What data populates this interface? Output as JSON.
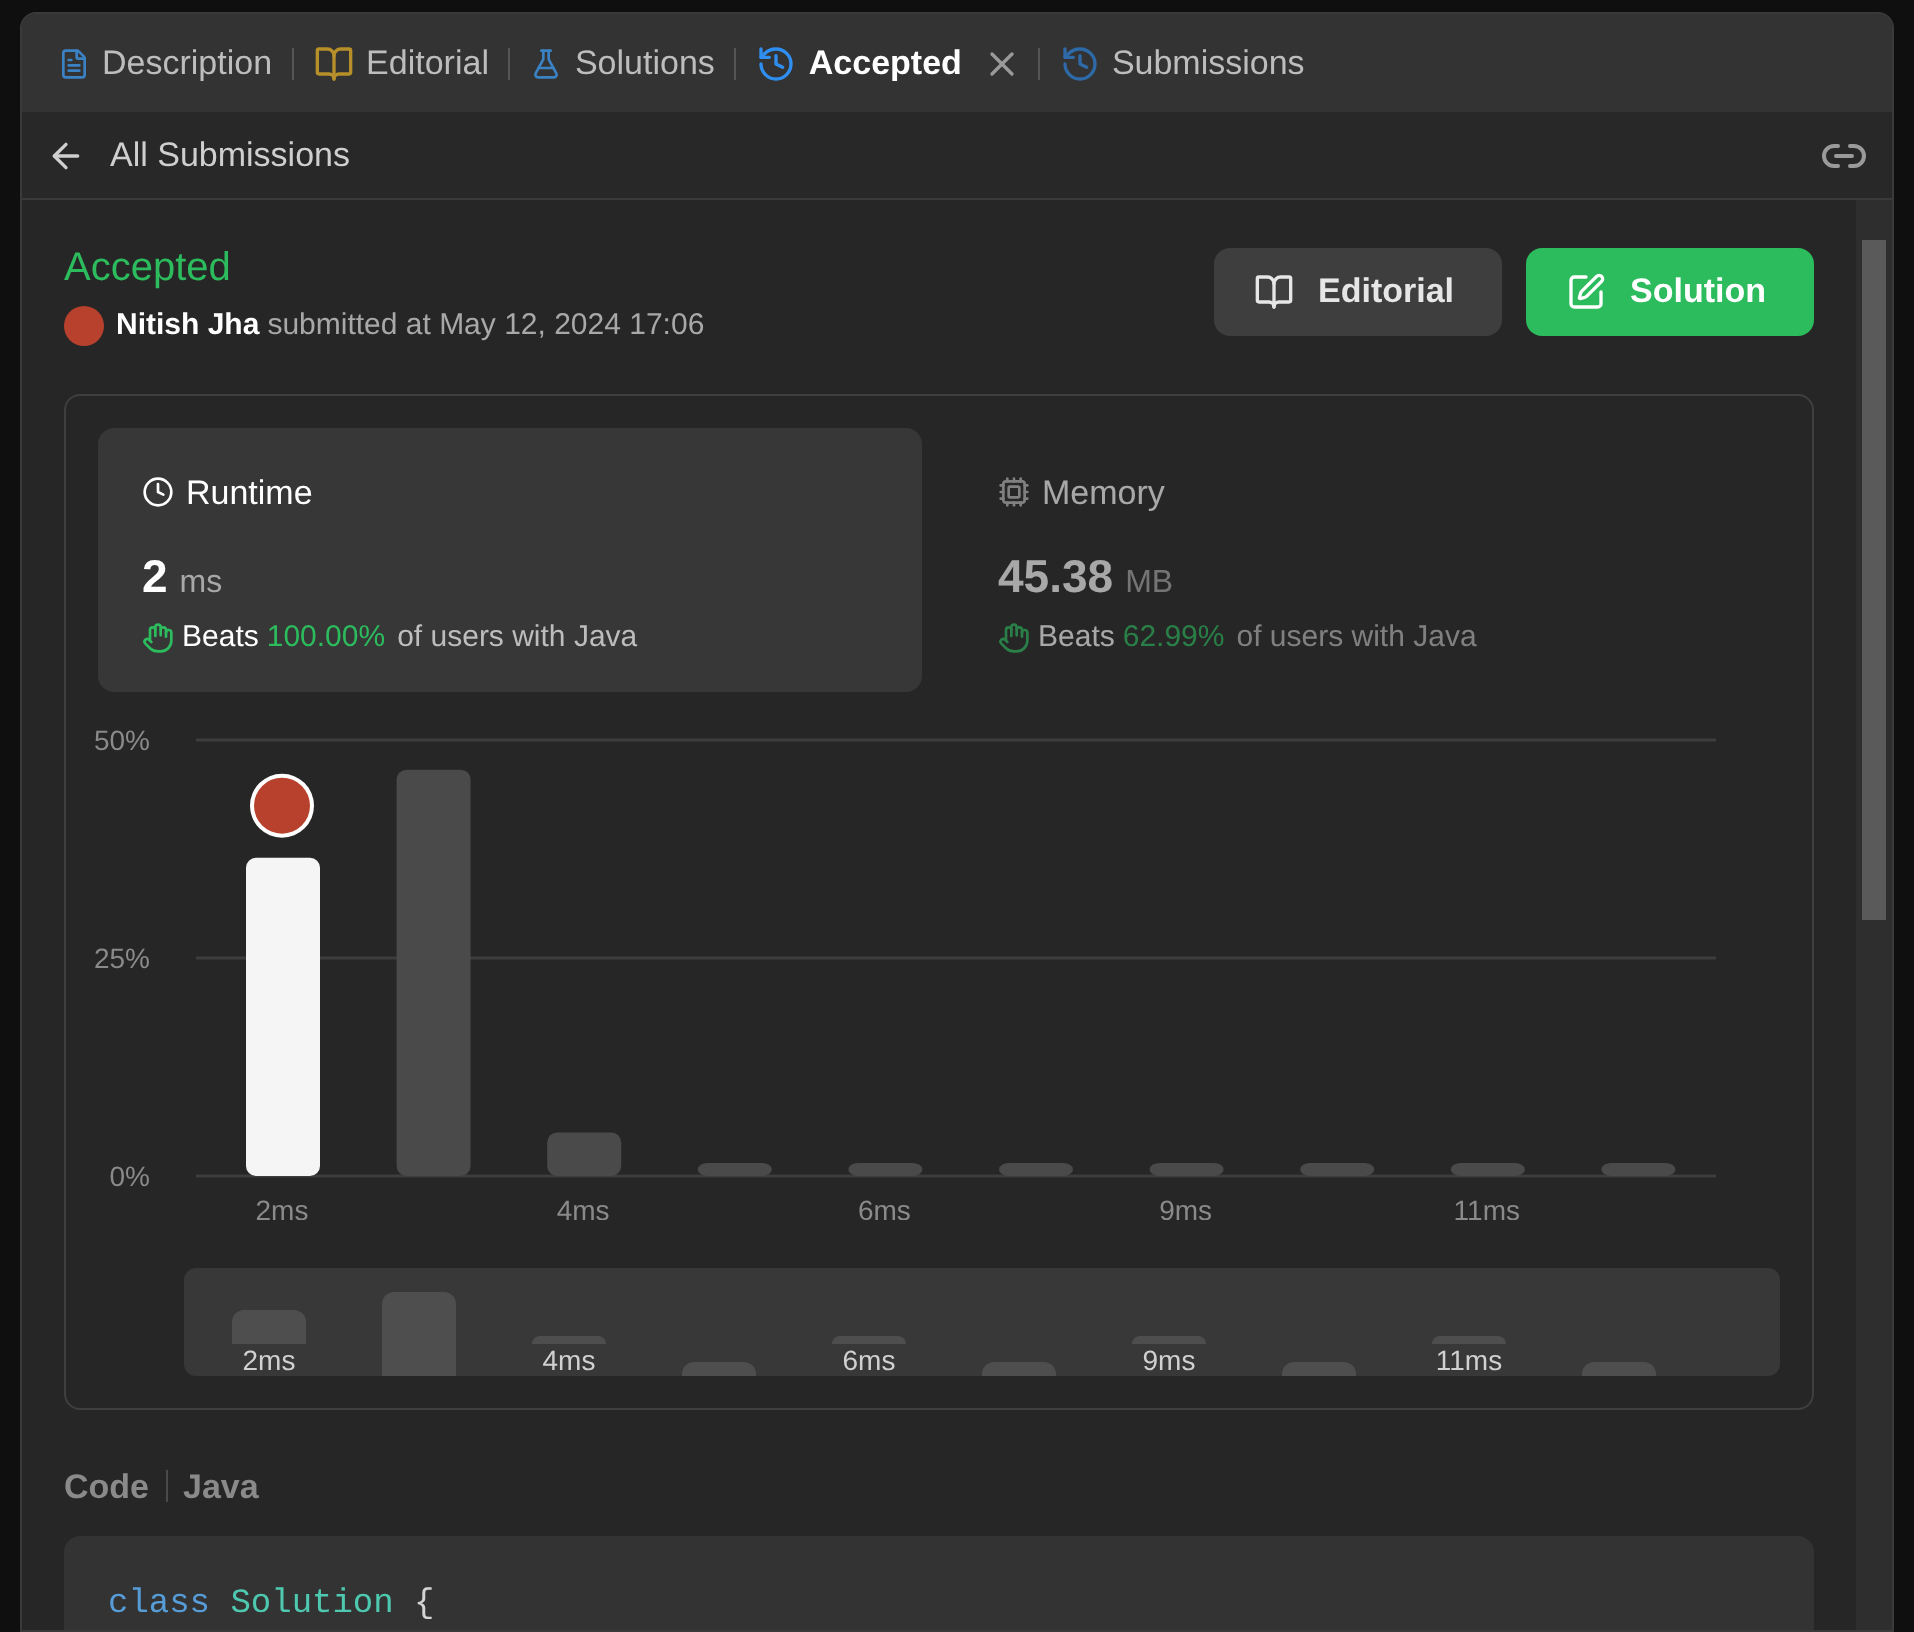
{
  "tabs": [
    {
      "label": "Description",
      "selected": false,
      "closable": false
    },
    {
      "label": "Editorial",
      "selected": false,
      "closable": false
    },
    {
      "label": "Solutions",
      "selected": false,
      "closable": false
    },
    {
      "label": "Accepted",
      "selected": true,
      "closable": true
    },
    {
      "label": "Submissions",
      "selected": false,
      "closable": false
    }
  ],
  "back_link": "All Submissions",
  "status": "Accepted",
  "author": "Nitish Jha",
  "submitted_text": "submitted at May 12, 2024 17:06",
  "buttons": [
    {
      "label": "Editorial",
      "kind": "secondary"
    },
    {
      "label": "Solution",
      "kind": "primary"
    }
  ],
  "metrics": [
    {
      "title": "Runtime",
      "value": "2",
      "unit": "ms",
      "beats_label": "Beats",
      "beats": "100.00%",
      "suffix": "of users with Java",
      "selected": true
    },
    {
      "title": "Memory",
      "value": "45.38",
      "unit": "MB",
      "beats_label": "Beats",
      "beats": "62.99%",
      "suffix": "of users with Java",
      "selected": false
    }
  ],
  "chart_data": {
    "type": "bar",
    "categories": [
      "2ms",
      null,
      "4ms",
      null,
      "6ms",
      null,
      "9ms",
      null,
      "11ms",
      null
    ],
    "series": [
      {
        "color": "#4a4a4a",
        "values": [
          null,
          46.6,
          5,
          1.5,
          1.5,
          1.5,
          1.5,
          1.5,
          1.5,
          1.5
        ]
      },
      {
        "color": "#f5f5f5",
        "values": [
          36.5,
          null,
          null,
          null,
          null,
          null,
          null,
          null,
          null,
          null
        ]
      }
    ],
    "ylim": [
      0,
      50
    ],
    "yticks": [
      {
        "value": 0,
        "label": "0%"
      },
      {
        "value": 25,
        "label": "25%"
      },
      {
        "value": 50,
        "label": "50%"
      }
    ],
    "stacked": true
  },
  "navigator_labels": [
    "2ms",
    "4ms",
    "6ms",
    "9ms",
    "11ms"
  ],
  "code_title": "Code",
  "code_language": "Java",
  "code_tokens": [
    {
      "text": "class",
      "kind": "keyword"
    },
    {
      "text": "Solution",
      "kind": "type"
    },
    {
      "text": "{",
      "kind": "plain"
    }
  ]
}
